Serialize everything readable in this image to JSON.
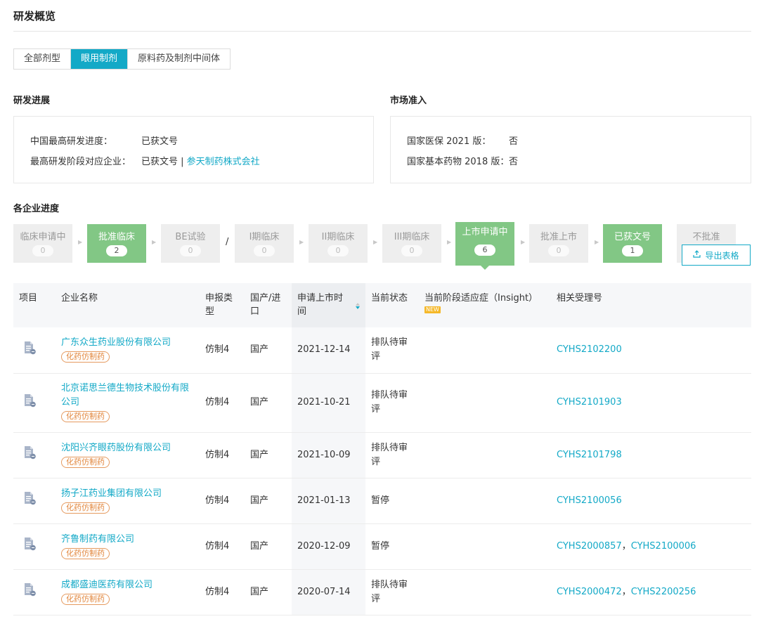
{
  "page": {
    "title": "研发概览"
  },
  "tabs": [
    {
      "label": "全部剂型",
      "active": false
    },
    {
      "label": "眼用制剂",
      "active": true
    },
    {
      "label": "原料药及制剂中间体",
      "active": false
    }
  ],
  "progress": {
    "title": "研发进展",
    "rows": [
      {
        "key": "中国最高研发进度：",
        "value": "已获文号"
      },
      {
        "key": "最高研发阶段对应企业：",
        "value": "已获文号 | ",
        "company": "参天制药株式会社"
      }
    ]
  },
  "market": {
    "title": "市场准入",
    "rows": [
      {
        "key": "国家医保 2021 版：",
        "value": "否"
      },
      {
        "key": "国家基本药物 2018 版：",
        "value": "否"
      }
    ]
  },
  "stages": {
    "title": "各企业进度",
    "items": [
      {
        "label": "临床申请中",
        "count": "0",
        "green": false
      },
      {
        "label": "批准临床",
        "count": "2",
        "green": true
      },
      {
        "label": "BE试验",
        "count": "0",
        "green": false
      },
      {
        "label": "I期临床",
        "count": "0",
        "green": false
      },
      {
        "label": "II期临床",
        "count": "0",
        "green": false
      },
      {
        "label": "III期临床",
        "count": "0",
        "green": false
      },
      {
        "label": "上市申请中",
        "count": "6",
        "green": true,
        "selected": true
      },
      {
        "label": "批准上市",
        "count": "0",
        "green": false
      },
      {
        "label": "已获文号",
        "count": "1",
        "green": true
      },
      {
        "label": "不批准",
        "count": "",
        "green": false
      }
    ],
    "separator": "/",
    "export_label": "导出表格"
  },
  "table": {
    "headers": {
      "item": "项目",
      "company": "企业名称",
      "type": "申报类型",
      "origin": "国产/进口",
      "date": "申请上市时间",
      "status": "当前状态",
      "indication": "当前阶段适应症（Insight）",
      "new_badge": "NEW",
      "refs": "相关受理号"
    },
    "rows": [
      {
        "company": "广东众生药业股份有限公司",
        "tag": "化药仿制药",
        "type": "仿制4",
        "origin": "国产",
        "date": "2021-12-14",
        "status": "排队待审评",
        "indication": "",
        "refs": [
          "CYHS2102200"
        ]
      },
      {
        "company": "北京诺思兰德生物技术股份有限公司",
        "tag": "化药仿制药",
        "type": "仿制4",
        "origin": "国产",
        "date": "2021-10-21",
        "status": "排队待审评",
        "indication": "",
        "refs": [
          "CYHS2101903"
        ]
      },
      {
        "company": "沈阳兴齐眼药股份有限公司",
        "tag": "化药仿制药",
        "type": "仿制4",
        "origin": "国产",
        "date": "2021-10-09",
        "status": "排队待审评",
        "indication": "",
        "refs": [
          "CYHS2101798"
        ]
      },
      {
        "company": "扬子江药业集团有限公司",
        "tag": "化药仿制药",
        "type": "仿制4",
        "origin": "国产",
        "date": "2021-01-13",
        "status": "暂停",
        "indication": "",
        "refs": [
          "CYHS2100056"
        ]
      },
      {
        "company": "齐鲁制药有限公司",
        "tag": "化药仿制药",
        "type": "仿制4",
        "origin": "国产",
        "date": "2020-12-09",
        "status": "暂停",
        "indication": "",
        "refs": [
          "CYHS2000857",
          "CYHS2100006"
        ]
      },
      {
        "company": "成都盛迪医药有限公司",
        "tag": "化药仿制药",
        "type": "仿制4",
        "origin": "国产",
        "date": "2020-07-14",
        "status": "排队待审评",
        "indication": "",
        "refs": [
          "CYHS2000472",
          "CYHS2200256"
        ]
      }
    ]
  }
}
